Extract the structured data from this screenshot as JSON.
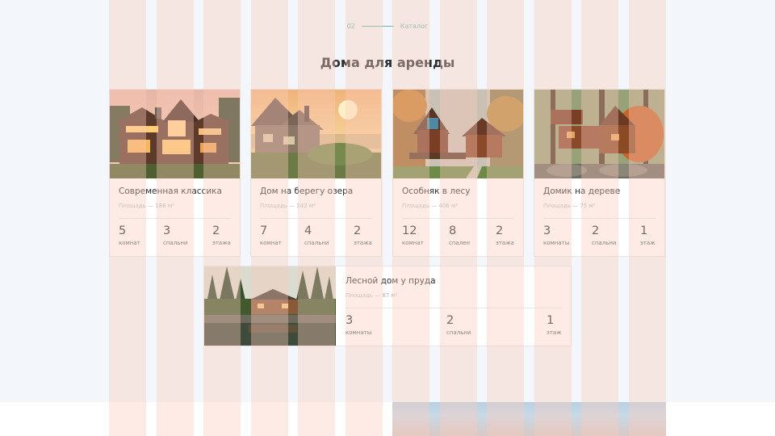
{
  "section": {
    "number": "02",
    "name": "Каталог"
  },
  "title": "Дома для аренды",
  "cards": [
    {
      "title": "Современная классика",
      "area": "Площадь — 186 м²",
      "stats": [
        {
          "num": "5",
          "label": "комнат"
        },
        {
          "num": "3",
          "label": "спальни"
        },
        {
          "num": "2",
          "label": "этажа"
        }
      ]
    },
    {
      "title": "Дом на берегу озера",
      "area": "Площадь — 242 м²",
      "stats": [
        {
          "num": "7",
          "label": "комнат"
        },
        {
          "num": "4",
          "label": "спальни"
        },
        {
          "num": "2",
          "label": "этажа"
        }
      ]
    },
    {
      "title": "Особняк в лесу",
      "area": "Площадь — 406 м²",
      "stats": [
        {
          "num": "12",
          "label": "комнат"
        },
        {
          "num": "8",
          "label": "спален"
        },
        {
          "num": "2",
          "label": "этажа"
        }
      ]
    },
    {
      "title": "Домик на дереве",
      "area": "Площадь — 75 м²",
      "stats": [
        {
          "num": "3",
          "label": "комнаты"
        },
        {
          "num": "2",
          "label": "спальни"
        },
        {
          "num": "1",
          "label": "этаж"
        }
      ]
    },
    {
      "title": "Лесной дом у пруда",
      "area": "Площадь — 87 м²",
      "stats": [
        {
          "num": "3",
          "label": "комнаты"
        },
        {
          "num": "2",
          "label": "спальни"
        },
        {
          "num": "1",
          "label": "этаж"
        }
      ]
    }
  ]
}
